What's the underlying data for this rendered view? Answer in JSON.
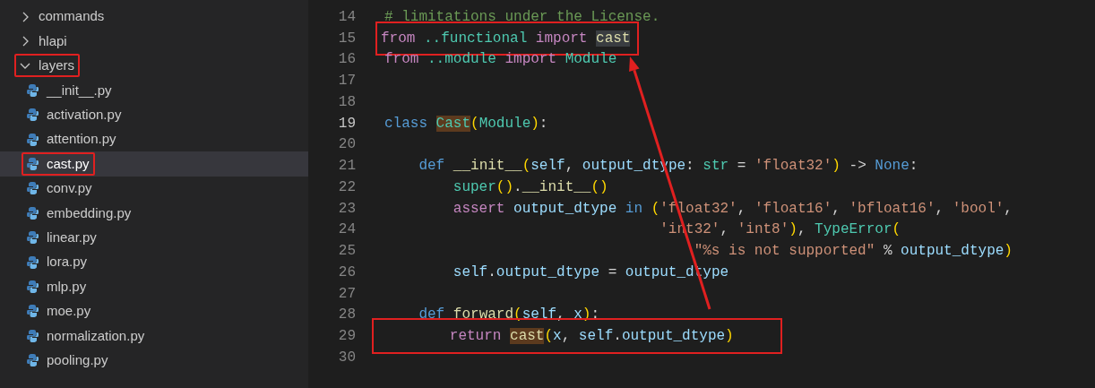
{
  "explorer": {
    "items": [
      {
        "label": "commands",
        "kind": "folder",
        "expanded": false,
        "selected": false,
        "boxed": false
      },
      {
        "label": "hlapi",
        "kind": "folder",
        "expanded": false,
        "selected": false,
        "boxed": false
      },
      {
        "label": "layers",
        "kind": "folder",
        "expanded": true,
        "selected": false,
        "boxed": true,
        "children": [
          {
            "label": "__init__.py",
            "kind": "python",
            "selected": false,
            "boxed": false
          },
          {
            "label": "activation.py",
            "kind": "python",
            "selected": false,
            "boxed": false
          },
          {
            "label": "attention.py",
            "kind": "python",
            "selected": false,
            "boxed": false
          },
          {
            "label": "cast.py",
            "kind": "python",
            "selected": true,
            "boxed": true
          },
          {
            "label": "conv.py",
            "kind": "python",
            "selected": false,
            "boxed": false
          },
          {
            "label": "embedding.py",
            "kind": "python",
            "selected": false,
            "boxed": false
          },
          {
            "label": "linear.py",
            "kind": "python",
            "selected": false,
            "boxed": false
          },
          {
            "label": "lora.py",
            "kind": "python",
            "selected": false,
            "boxed": false
          },
          {
            "label": "mlp.py",
            "kind": "python",
            "selected": false,
            "boxed": false
          },
          {
            "label": "moe.py",
            "kind": "python",
            "selected": false,
            "boxed": false
          },
          {
            "label": "normalization.py",
            "kind": "python",
            "selected": false,
            "boxed": false
          },
          {
            "label": "pooling.py",
            "kind": "python",
            "selected": false,
            "boxed": false
          }
        ]
      }
    ]
  },
  "editor": {
    "lines": [
      {
        "number": "14",
        "current": false,
        "tokens": [
          {
            "t": "# limitations under the License.",
            "kind": "comment"
          }
        ]
      },
      {
        "number": "15",
        "current": false,
        "boxed": true,
        "tokens": [
          {
            "t": "from",
            "kind": "keyword"
          },
          {
            "t": " ..functional",
            "kind": "type"
          },
          {
            "t": " import ",
            "kind": "keyword"
          },
          {
            "t": "cast",
            "kind": "func",
            "highlighted": true,
            "write": false
          }
        ]
      },
      {
        "number": "16",
        "current": false,
        "tokens": [
          {
            "t": "from",
            "kind": "keyword"
          },
          {
            "t": " ..module",
            "kind": "type"
          },
          {
            "t": " import",
            "kind": "keyword"
          },
          {
            "t": " Module",
            "kind": "type"
          }
        ]
      },
      {
        "number": "17",
        "current": false
      },
      {
        "number": "18",
        "current": false
      },
      {
        "number": "19",
        "current": true,
        "tokens": [
          {
            "t": "class ",
            "kind": "storage"
          },
          {
            "t": "Cast",
            "kind": "type",
            "highlighted": true,
            "write": true
          },
          {
            "t": "(",
            "kind": "paren"
          },
          {
            "t": "Module",
            "kind": "type"
          },
          {
            "t": ")",
            "kind": "paren"
          },
          {
            "t": ":",
            "kind": "plain"
          }
        ]
      },
      {
        "number": "20",
        "current": false
      },
      {
        "number": "21",
        "current": false,
        "tokens": [
          {
            "t": "    def",
            "kind": "storage"
          },
          {
            "t": " __init__",
            "kind": "func"
          },
          {
            "t": "(",
            "kind": "paren"
          },
          {
            "t": "self",
            "kind": "var"
          },
          {
            "t": ", ",
            "kind": "plain"
          },
          {
            "t": "output_dtype",
            "kind": "var"
          },
          {
            "t": ": ",
            "kind": "plain"
          },
          {
            "t": "str",
            "kind": "type"
          },
          {
            "t": " = ",
            "kind": "plain"
          },
          {
            "t": "'float32'",
            "kind": "string"
          },
          {
            "t": ")",
            "kind": "paren"
          },
          {
            "t": " -> ",
            "kind": "plain"
          },
          {
            "t": "None",
            "kind": "storage"
          },
          {
            "t": ":",
            "kind": "plain"
          }
        ]
      },
      {
        "number": "22",
        "current": false,
        "tokens": [
          {
            "t": "        super",
            "kind": "type"
          },
          {
            "t": "()",
            "kind": "paren"
          },
          {
            "t": ".",
            "kind": "plain"
          },
          {
            "t": "__init__",
            "kind": "func"
          },
          {
            "t": "()",
            "kind": "paren"
          }
        ]
      },
      {
        "number": "23",
        "current": false,
        "tokens": [
          {
            "t": "        assert",
            "kind": "keyword"
          },
          {
            "t": " output_dtype",
            "kind": "var"
          },
          {
            "t": " in",
            "kind": "storage"
          },
          {
            "t": " (",
            "kind": "paren"
          },
          {
            "t": "'float32'",
            "kind": "string"
          },
          {
            "t": ", ",
            "kind": "plain"
          },
          {
            "t": "'float16'",
            "kind": "string"
          },
          {
            "t": ", ",
            "kind": "plain"
          },
          {
            "t": "'bfloat16'",
            "kind": "string"
          },
          {
            "t": ", ",
            "kind": "plain"
          },
          {
            "t": "'bool'",
            "kind": "string"
          },
          {
            "t": ",",
            "kind": "plain"
          }
        ]
      },
      {
        "number": "24",
        "current": false,
        "tokens": [
          {
            "t": "                                'int32'",
            "kind": "string"
          },
          {
            "t": ", ",
            "kind": "plain"
          },
          {
            "t": "'int8'",
            "kind": "string"
          },
          {
            "t": ")",
            "kind": "paren"
          },
          {
            "t": ", ",
            "kind": "plain"
          },
          {
            "t": "TypeError",
            "kind": "type"
          },
          {
            "t": "(",
            "kind": "paren"
          }
        ]
      },
      {
        "number": "25",
        "current": false,
        "tokens": [
          {
            "t": "                                    \"%s is not supported\"",
            "kind": "string"
          },
          {
            "t": " % ",
            "kind": "plain"
          },
          {
            "t": "output_dtype",
            "kind": "var"
          },
          {
            "t": ")",
            "kind": "paren"
          }
        ]
      },
      {
        "number": "26",
        "current": false,
        "tokens": [
          {
            "t": "        self",
            "kind": "var"
          },
          {
            "t": ".",
            "kind": "plain"
          },
          {
            "t": "output_dtype",
            "kind": "var"
          },
          {
            "t": " = ",
            "kind": "plain"
          },
          {
            "t": "output_dtype",
            "kind": "var"
          }
        ]
      },
      {
        "number": "27",
        "current": false
      },
      {
        "number": "28",
        "current": false,
        "tokens": [
          {
            "t": "    def",
            "kind": "storage"
          },
          {
            "t": " forward",
            "kind": "func"
          },
          {
            "t": "(",
            "kind": "paren"
          },
          {
            "t": "self",
            "kind": "var"
          },
          {
            "t": ", ",
            "kind": "plain"
          },
          {
            "t": "x",
            "kind": "var"
          },
          {
            "t": ")",
            "kind": "paren"
          },
          {
            "t": ":",
            "kind": "plain"
          }
        ]
      },
      {
        "number": "29",
        "current": false,
        "boxed": true,
        "tokens": [
          {
            "t": "        return ",
            "kind": "keyword"
          },
          {
            "t": "cast",
            "kind": "func",
            "highlighted": true,
            "write": true
          },
          {
            "t": "(",
            "kind": "paren"
          },
          {
            "t": "x",
            "kind": "var"
          },
          {
            "t": ", ",
            "kind": "plain"
          },
          {
            "t": "self",
            "kind": "var"
          },
          {
            "t": ".",
            "kind": "plain"
          },
          {
            "t": "output_dtype",
            "kind": "var"
          },
          {
            "t": ")",
            "kind": "paren"
          }
        ]
      },
      {
        "number": "30",
        "current": false
      }
    ]
  },
  "annotations": [
    {
      "kind": "arrow"
    }
  ]
}
